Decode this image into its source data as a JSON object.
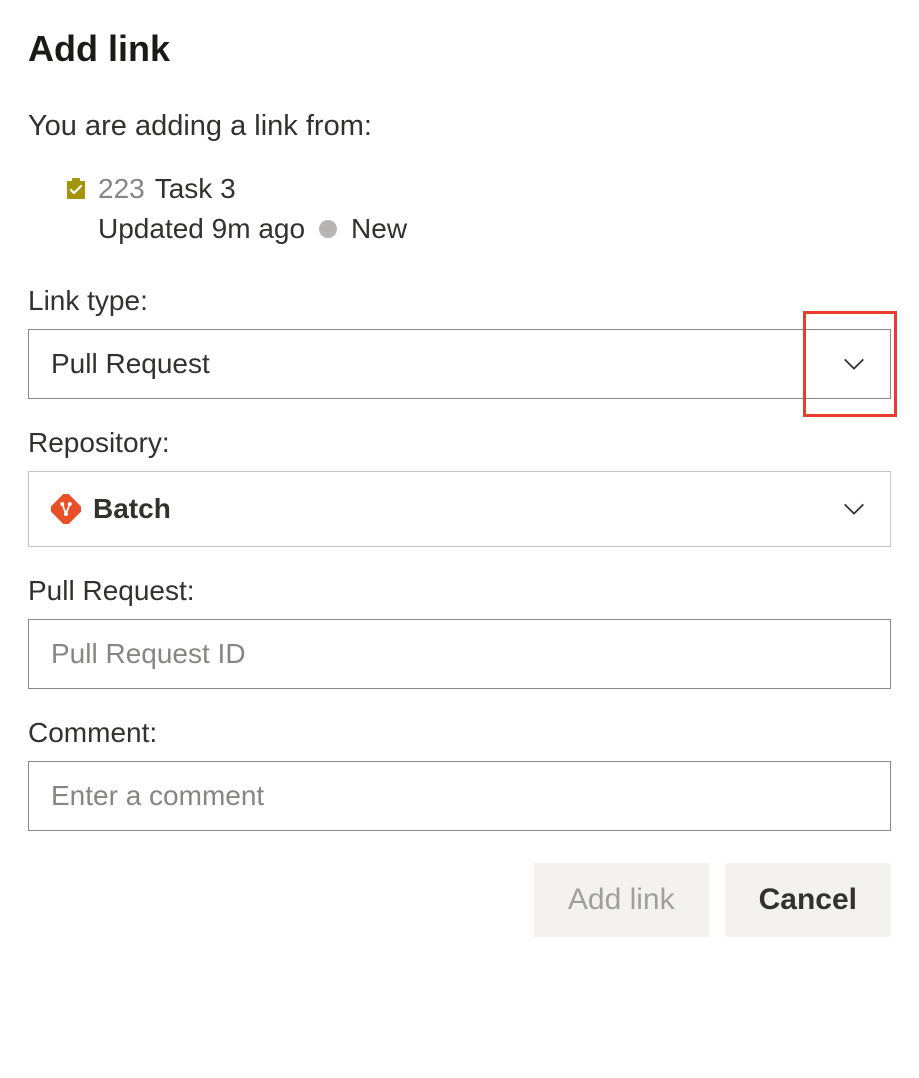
{
  "dialog": {
    "title": "Add link",
    "subtitle": "You are adding a link from:"
  },
  "workItem": {
    "id": "223",
    "title": "Task 3",
    "updated": "Updated 9m ago",
    "state": "New",
    "iconName": "task-icon"
  },
  "fields": {
    "linkType": {
      "label": "Link type:",
      "value": "Pull Request"
    },
    "repository": {
      "label": "Repository:",
      "value": "Batch",
      "iconName": "git-repo-icon"
    },
    "pullRequest": {
      "label": "Pull Request:",
      "placeholder": "Pull Request ID",
      "value": ""
    },
    "comment": {
      "label": "Comment:",
      "placeholder": "Enter a comment",
      "value": ""
    }
  },
  "buttons": {
    "addLink": "Add link",
    "cancel": "Cancel"
  }
}
